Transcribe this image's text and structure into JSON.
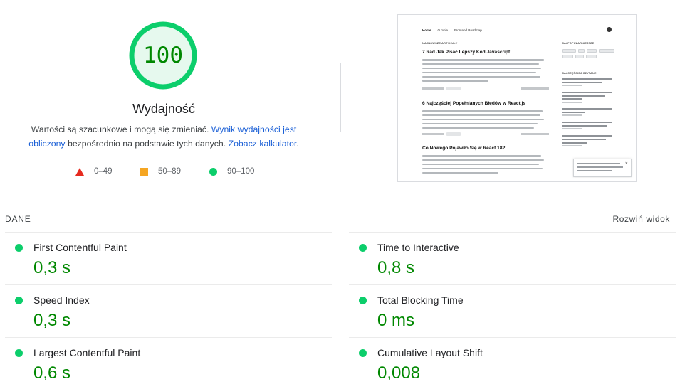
{
  "score": {
    "value": "100",
    "fraction": 1.0,
    "ring_color": "#0cce6b",
    "text_color": "#008800",
    "fill_color": "#e6f9ee"
  },
  "category": {
    "title": "Wydajność"
  },
  "description": {
    "text_before": "Wartości są szacunkowe i mogą się zmieniać. ",
    "link1": "Wynik wydajności jest obliczony",
    "text_middle": " bezpośrednio na podstawie tych danych. ",
    "link2": "Zobacz kalkulator",
    "text_after": "."
  },
  "legend": {
    "fail": {
      "label": "0–49",
      "icon": "triangle-icon",
      "color": "#e62a1f"
    },
    "average": {
      "label": "50–89",
      "icon": "square-icon",
      "color": "#f5a623"
    },
    "pass": {
      "label": "90–100",
      "icon": "circle-icon",
      "color": "#0cce6b"
    }
  },
  "metrics_header": {
    "title": "DANE",
    "expand": "Rozwiń widok"
  },
  "metrics_left": [
    {
      "title": "First Contentful Paint",
      "value": "0,3 s"
    },
    {
      "title": "Speed Index",
      "value": "0,3 s"
    },
    {
      "title": "Largest Contentful Paint",
      "value": "0,6 s"
    }
  ],
  "metrics_right": [
    {
      "title": "Time to Interactive",
      "value": "0,8 s"
    },
    {
      "title": "Total Blocking Time",
      "value": "0 ms"
    },
    {
      "title": "Cumulative Layout Shift",
      "value": "0,008"
    }
  ],
  "thumbnail": {
    "nav": [
      "Home",
      "O mnie",
      "Frontend Roadmap"
    ],
    "section_left": "NAJNOWSZE ARTYKUŁY",
    "section_right_1": "NAJPOPULARNIEJSZE",
    "section_right_2": "NAJCZĘŚCIEJ CZYTANE",
    "articles": [
      "7 Rad Jak Pisać Lepszy Kod Javascript",
      "6 Najczęściej Popełnianych Błędów w React.js",
      "Co Nowego Pojawiło Się w React 18?"
    ]
  }
}
